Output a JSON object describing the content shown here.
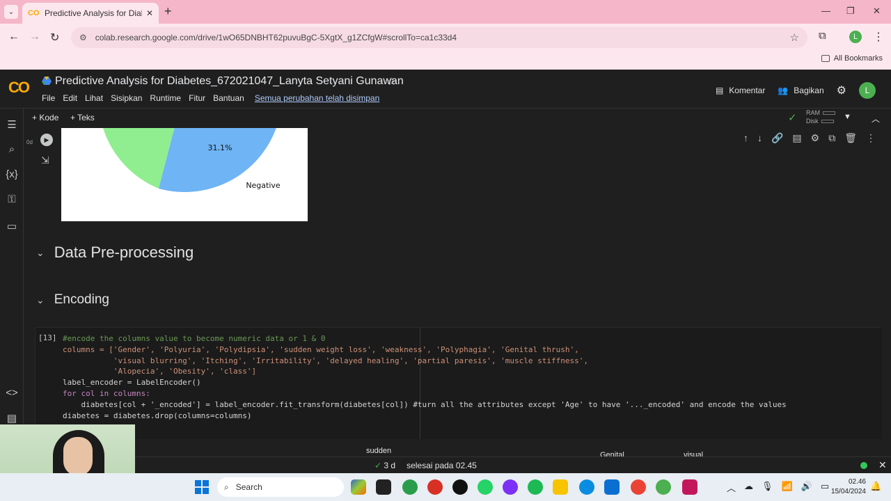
{
  "browser": {
    "tab_title": "Predictive Analysis for Diabetes",
    "url": "colab.research.google.com/drive/1wO65DNBHT62puvuBgC-5XgtX_g1ZCfgW#scrollTo=ca1c33d4",
    "bookmarks_label": "All Bookmarks",
    "profile_initial": "L"
  },
  "colab": {
    "logo": "CO",
    "notebook_title": "Predictive Analysis for Diabetes_672021047_Lanyta Setyani Gunawan",
    "menu": [
      "File",
      "Edit",
      "Lihat",
      "Sisipkan",
      "Runtime",
      "Fitur",
      "Bantuan"
    ],
    "saved_status": "Semua perubahan telah disimpan",
    "comment_label": "Komentar",
    "share_label": "Bagikan",
    "avatar_initial": "L",
    "add_code": "+ Kode",
    "add_text": "+ Teks",
    "ram_label": "RAM",
    "disk_label": "Disk"
  },
  "output_cell": {
    "gutter": "0d",
    "slice_label": "31.1%",
    "legend_label": "Negative"
  },
  "sections": {
    "preprocessing": "Data Pre-processing",
    "encoding": "Encoding"
  },
  "code_cell": {
    "exec_count": "[13]",
    "gutter": "0d",
    "lines": [
      "#encode the columns value to become numeric data or 1 & 0",
      "columns = ['Gender', 'Polyuria', 'Polydipsia', 'sudden weight loss', 'weakness', 'Polyphagia', 'Genital thrush',",
      "           'visual blurring', 'Itching', 'Irritability', 'delayed healing', 'partial paresis', 'muscle stiffness',",
      "           'Alopecia', 'Obesity', 'class']",
      "label_encoder = LabelEncoder()",
      "for col in columns:",
      "    diabetes[col + '_encoded'] = label_encoder.fit_transform(diabetes[col]) #turn all the attributes except 'Age' to have '..._encoded' and encode the values",
      "diabetes = diabetes.drop(columns=columns)"
    ]
  },
  "output_header": {
    "col_sudden": "sudden",
    "col_genital": "Genital",
    "col_visual": "visual"
  },
  "status": {
    "duration": "3 d",
    "completed": "selesai pada 02.45"
  },
  "taskbar": {
    "search_placeholder": "Search",
    "time": "02.46",
    "date": "15/04/2024"
  },
  "colors": {
    "pie_green": "#90ee90",
    "pie_blue": "#6fb4f5",
    "accent_orange": "#f9ab00"
  }
}
